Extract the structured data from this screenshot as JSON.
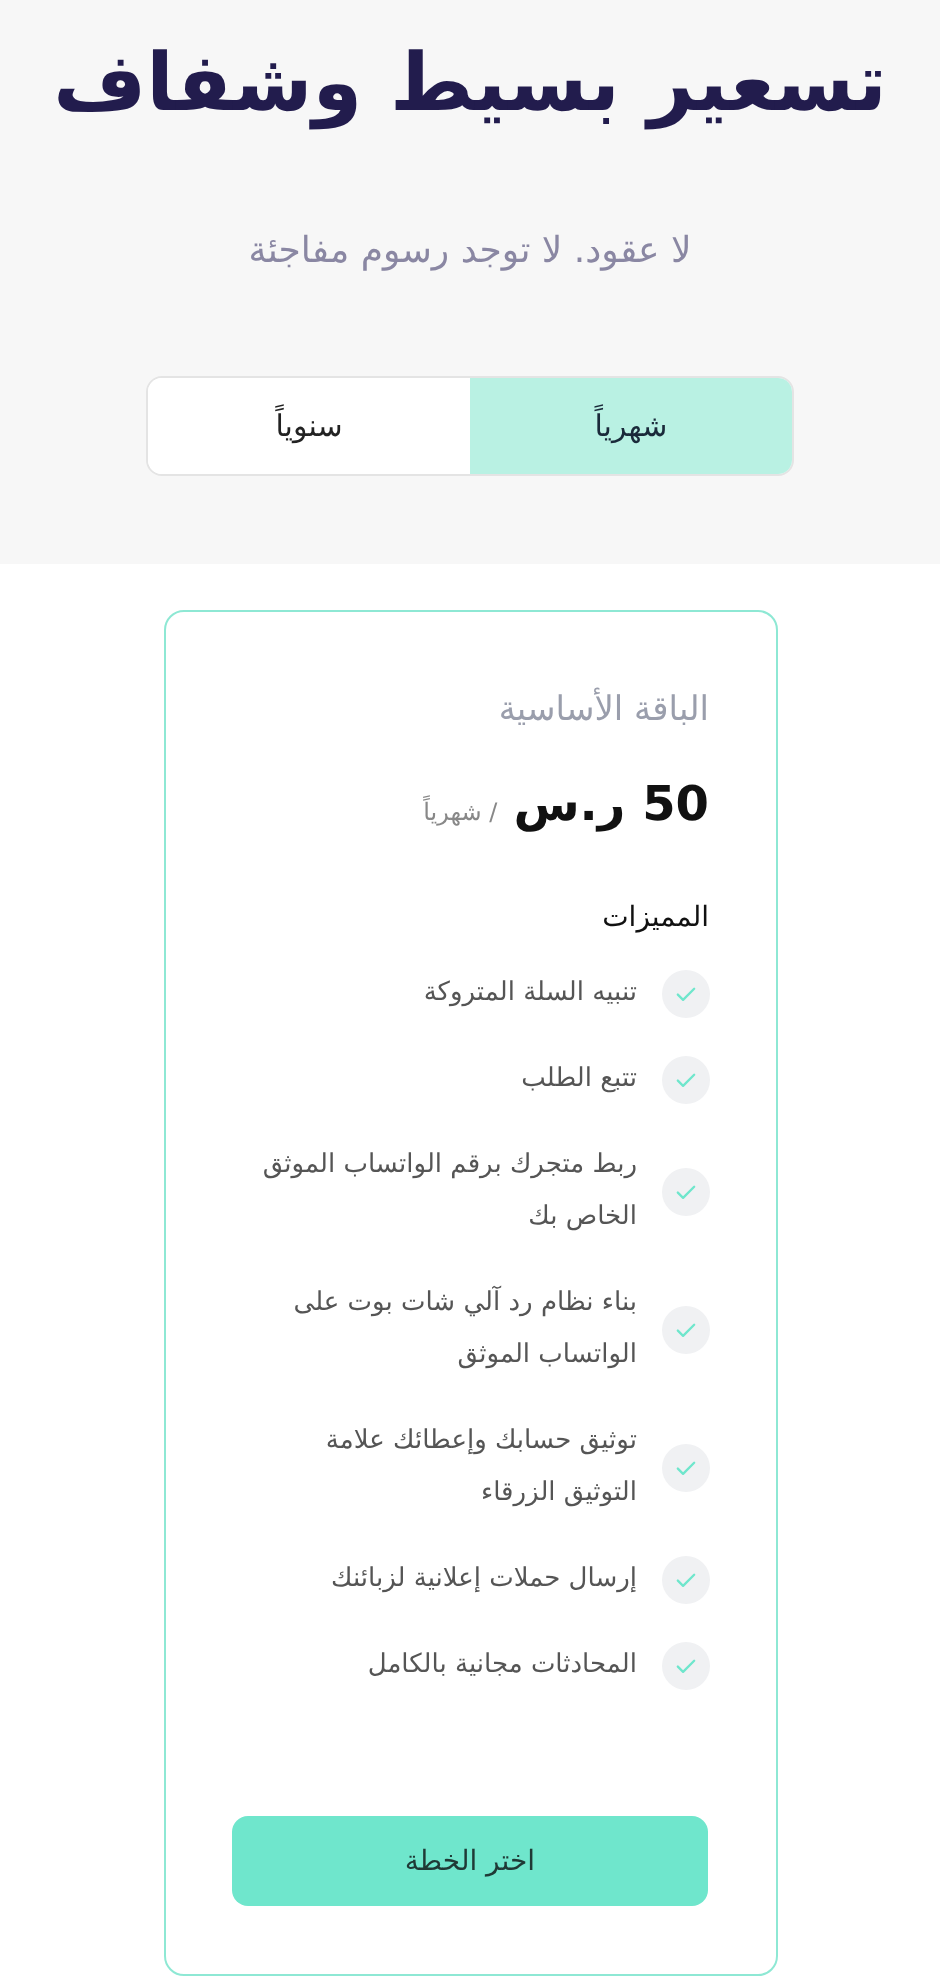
{
  "header": {
    "title": "تسعير بسيط وشفاف",
    "subtitle": "لا عقود. لا توجد رسوم مفاجئة"
  },
  "billing_toggle": [
    {
      "label": "شهرياً",
      "selected": true
    },
    {
      "label": "سنوياً",
      "selected": false
    }
  ],
  "plan": {
    "name": "الباقة الأساسية",
    "price": "50 ر.س",
    "period": "/ شهرياً",
    "features_heading": "المميزات",
    "features": [
      "تنبيه السلة المتروكة",
      "تتبع الطلب",
      "ربط متجرك برقم الواتساب الموثق الخاص بك",
      "بناء نظام رد آلي شات بوت على الواتساب الموثق",
      "توثيق حسابك وإعطائك علامة التوثيق الزرقاء",
      "إرسال حملات إعلانية لزبائنك",
      "المحادثات مجانية بالكامل"
    ],
    "button": "اختر الخطة"
  }
}
